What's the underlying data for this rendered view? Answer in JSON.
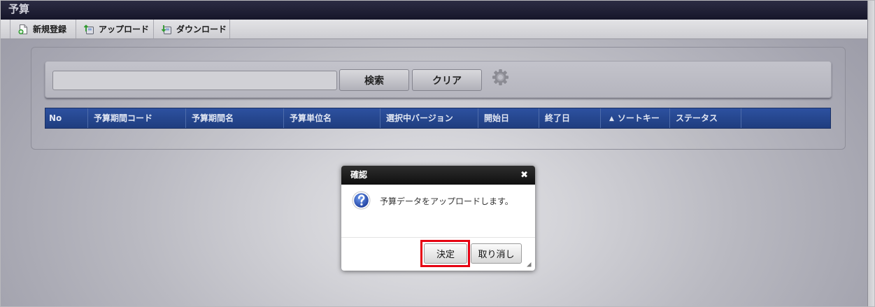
{
  "window": {
    "title": "予算"
  },
  "toolbar": {
    "items": [
      {
        "label": "新規登録",
        "icon": "new-document-icon"
      },
      {
        "label": "アップロード",
        "icon": "upload-icon"
      },
      {
        "label": "ダウンロード",
        "icon": "download-icon"
      }
    ]
  },
  "search": {
    "search_button_label": "検索",
    "clear_button_label": "クリア",
    "settings_icon": "gear-icon"
  },
  "table": {
    "columns": [
      {
        "label": "No"
      },
      {
        "label": "予算期間コード"
      },
      {
        "label": "予算期間名"
      },
      {
        "label": "予算単位名"
      },
      {
        "label": "選択中バージョン"
      },
      {
        "label": "開始日"
      },
      {
        "label": "終了日"
      },
      {
        "label": "ソートキー",
        "sort_indicator": "▲"
      },
      {
        "label": "ステータス"
      }
    ],
    "rows": []
  },
  "dialog": {
    "title": "確認",
    "close_glyph": "✖",
    "icon": "question-icon",
    "message": "予算データをアップロードします。",
    "confirm_button_label": "決定",
    "cancel_button_label": "取り消し"
  },
  "colors": {
    "title_bar": "#1c1c30",
    "table_header": "#26468a",
    "dialog_header": "#1e1e1e",
    "highlight": "#e60012"
  }
}
